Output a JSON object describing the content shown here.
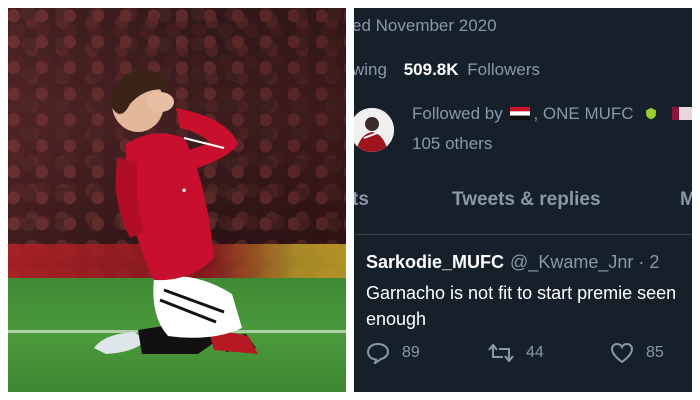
{
  "profile": {
    "joined": "ed November 2020",
    "following_fragment": "wing",
    "followers_count": "509.8K",
    "followers_label": "Followers",
    "followed_by_prefix": "Followed by",
    "followed_by_names": ", ONE MUFC",
    "followed_by_others": "105 others"
  },
  "tabs": [
    {
      "label": "ts"
    },
    {
      "label": "Tweets & replies"
    },
    {
      "label": "M"
    }
  ],
  "tweet": {
    "display_name": "Sarkodie_MUFC",
    "handle": "@_Kwame_Jnr · 2",
    "text": "Garnacho is not fit to start premie seen enough",
    "replies": "89",
    "retweets": "44",
    "likes": "85"
  },
  "colors": {
    "tweet_bg": "#15202b",
    "muted_text": "#8b98a5",
    "kit_red": "#c8102e"
  },
  "icons": [
    "reply-icon",
    "retweet-icon",
    "like-icon",
    "verified-badge-icon"
  ]
}
